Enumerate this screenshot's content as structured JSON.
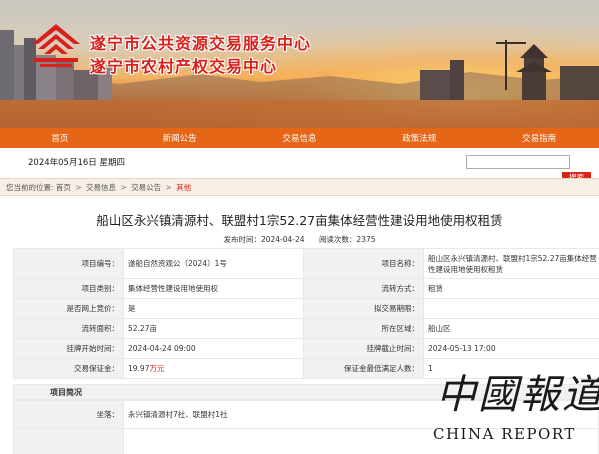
{
  "header": {
    "title_line1": "遂宁市公共资源交易服务中心",
    "title_line2": "遂宁市农村产权交易中心"
  },
  "nav": {
    "items": [
      "首页",
      "新闻公告",
      "交易信息",
      "政策法规",
      "交易指南"
    ]
  },
  "topbar": {
    "date": "2024年05月16日  星期四",
    "search_button": "搜索",
    "search_placeholder": ""
  },
  "breadcrumb": {
    "prefix": "您当前的位置:",
    "items": [
      "首页",
      "交易信息",
      "交易公告",
      "其他"
    ],
    "separator": ">"
  },
  "article": {
    "title": "船山区永兴镇清源村、联盟村1宗52.27亩集体经营性建设用地使用权租赁",
    "publish_time": "发布时间：2024-04-24",
    "views": "阅读次数：2375"
  },
  "table": {
    "rows": [
      {
        "l1": "项目编号：",
        "v1": "遂船自然资观公〔2024〕1号",
        "l2": "项目名称：",
        "v2": "船山区永兴镇清源村、联盟村1宗52.27亩集体经营性建设用地使用权租赁"
      },
      {
        "l1": "项目类别：",
        "v1": "集体经营性建设用地使用权",
        "l2": "流转方式：",
        "v2": "租赁"
      },
      {
        "l1": "是否网上竞价：",
        "v1": "是",
        "l2": "拟交易期限：",
        "v2": ""
      },
      {
        "l1": "流转面积：",
        "v1": "52.27亩",
        "l2": "所在区域：",
        "v2": "船山区"
      },
      {
        "l1": "挂牌开始时间：",
        "v1": "2024-04-24 09:00",
        "l2": "挂牌截止时间：",
        "v2": "2024-05-13 17:00"
      },
      {
        "l1": "交易保证金：",
        "v1_num": "19.97",
        "v1_unit": "万元",
        "l2": "保证金最低满足人数：",
        "v2": "1"
      }
    ]
  },
  "section": {
    "title": "项目简况",
    "location_label": "坐落：",
    "location_value": "永兴镇清源村7社、联盟村1社"
  },
  "watermark": {
    "cn": "中國報道",
    "en": "CHINA REPORT"
  },
  "colors": {
    "nav_orange": "#e46616",
    "title_red": "#d8201c",
    "accent_red": "#d9261c"
  }
}
